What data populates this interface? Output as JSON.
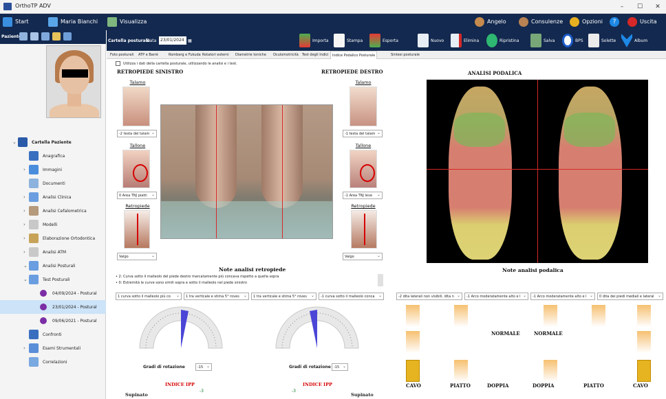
{
  "window": {
    "title": "OrthoTP ADV"
  },
  "topnav": {
    "start": "Start",
    "user": "Maria Bianchi",
    "view": "Visualizza",
    "angelo": "Angelo",
    "consulenze": "Consulenze",
    "opzioni": "Opzioni",
    "uscita": "Uscita"
  },
  "sidebar": {
    "paziente": "Paziente",
    "items": [
      {
        "label": "Cartella Paziente"
      },
      {
        "label": "Anagrafica"
      },
      {
        "label": "Immagini"
      },
      {
        "label": "Documenti"
      },
      {
        "label": "Analisi Clinica"
      },
      {
        "label": "Analisi Cefalometrica"
      },
      {
        "label": "Modelli"
      },
      {
        "label": "Elaborazione Ortodontica"
      },
      {
        "label": "Analisi ATM"
      },
      {
        "label": "Analisi Posturali"
      },
      {
        "label": "Test Posturali"
      },
      {
        "label": "04/09/2024 - Postural"
      },
      {
        "label": "23/01/2024 - Postural"
      },
      {
        "label": "09/06/2021 - Postural"
      },
      {
        "label": "Confronti"
      },
      {
        "label": "Esami Strumentali"
      },
      {
        "label": "Correlazioni"
      }
    ]
  },
  "toolbar": {
    "cartella": "Cartella posturale",
    "data_label": "Data",
    "data_value": "23/01/2024",
    "importa": "Importa",
    "stampa": "Stampa",
    "esporta": "Esporta",
    "nuovo": "Nuovo",
    "elimina": "Elimina",
    "ripristina": "Ripristina",
    "salva": "Salva",
    "bps": "BPS",
    "solette": "Solette",
    "album": "Album"
  },
  "tabs": [
    "Foto posturali",
    "ATP e Barré",
    "Romberg e Fukuda",
    "Rotatori esterni",
    "Diametrie toniche",
    "Oculomotricità",
    "Test degli Indici",
    "Indice Podalico Posturale",
    "Sintesi posturale"
  ],
  "checkbox_label": "Utilizza i dati della cartella posturale, utilizzando le analisi e i test.",
  "left": {
    "title": "RETROPIEDE SINISTRO",
    "talamo": "Talamo",
    "tallone": "Tallone",
    "retropiede": "Retropiede",
    "sel_talamo": "-2 testa del talam",
    "sel_tallone": "0 Area TNJ piatti",
    "sel_retro": "Valgo"
  },
  "right": {
    "title": "RETROPIEDE DESTRO",
    "talamo": "Talamo",
    "tallone": "Tallone",
    "retropiede": "Retropiede",
    "sel_talamo": "-1 testa del talam",
    "sel_tallone": "-1 Area TNJ leve",
    "sel_retro": "Valgo"
  },
  "note_retro": {
    "title": "Note analisi retropiede",
    "line1": "• 2: Curva sotto il malleolo del piede destro marcatamente più concava rispetto a quella sopra",
    "line2": "• 0: Estremità le curve sono simili sopra e sotto il malleolo nel piede sinistro"
  },
  "retro_selects": [
    "1 curva sotto il malleolo più co",
    "1 tra verticale e stima 5° roves",
    "1 tra verticale e stima 5° roves",
    "-1 curva sotto il malleolo conca"
  ],
  "gauge_left": {
    "label": "Gradi di rotazione",
    "value": "-15",
    "ipp": "INDICE IPP",
    "supinato": "Supinato",
    "ipp_value": "-3"
  },
  "gauge_right": {
    "label": "Gradi di rotazione",
    "value": "-15",
    "ipp": "INDICE IPP",
    "supinato": "Supinato",
    "ipp_value": "-3"
  },
  "podalica": {
    "title": "ANALISI PODALICA",
    "note": "Note analisi podalica",
    "selects": [
      "-2 dita laterali non visibili, dita n",
      "-1 Arco moderatamente alto e l",
      "-1 Arco moderatamente alto e l",
      "0 dita dei piedi mediali e lateral"
    ],
    "labels_mid": [
      "NORMALE",
      "NORMALE"
    ],
    "labels_bottom": [
      "CAVO",
      "PIATTO",
      "DOPPIA",
      "DOPPIA",
      "PIATTO",
      "CAVO"
    ]
  },
  "colors": {
    "nav": "#13294f",
    "accent_red": "#d60000",
    "gauge_needle": "#4b46d6"
  }
}
